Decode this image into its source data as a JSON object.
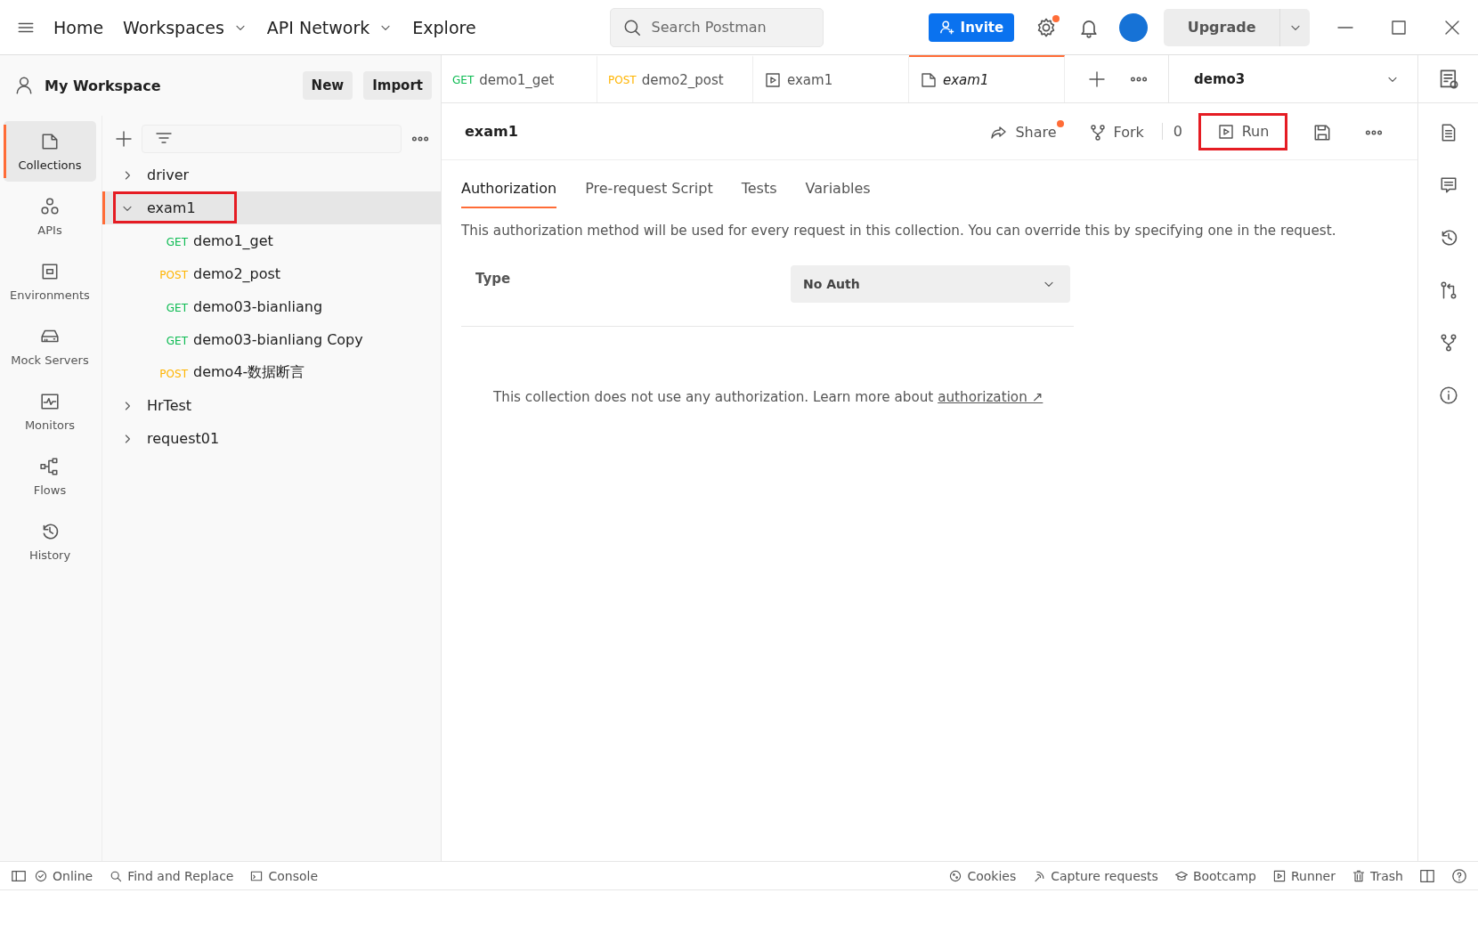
{
  "topbar": {
    "nav": [
      {
        "label": "Home",
        "dropdown": false
      },
      {
        "label": "Workspaces",
        "dropdown": true
      },
      {
        "label": "API Network",
        "dropdown": true
      },
      {
        "label": "Explore",
        "dropdown": false
      }
    ],
    "search": {
      "placeholder": "Search Postman"
    },
    "invite": "Invite",
    "settings_badge": true,
    "upgrade": "Upgrade"
  },
  "workspace": {
    "name": "My Workspace",
    "buttons": [
      "New",
      "Import"
    ]
  },
  "sidebar": {
    "items": [
      {
        "label": "Collections",
        "selected": true
      },
      {
        "label": "APIs",
        "selected": false
      },
      {
        "label": "Environments",
        "selected": false
      },
      {
        "label": "Mock Servers",
        "selected": false
      },
      {
        "label": "Monitors",
        "selected": false
      },
      {
        "label": "Flows",
        "selected": false
      },
      {
        "label": "History",
        "selected": false
      }
    ]
  },
  "tree": [
    {
      "label": "driver",
      "expanded": false,
      "selected": false,
      "annotated": false
    },
    {
      "label": "exam1",
      "expanded": true,
      "selected": true,
      "annotated": true,
      "children": [
        {
          "method": "GET",
          "label": "demo1_get"
        },
        {
          "method": "POST",
          "label": "demo2_post"
        },
        {
          "method": "GET",
          "label": "demo03-bianliang"
        },
        {
          "method": "GET",
          "label": "demo03-bianliang Copy"
        },
        {
          "method": "POST",
          "label": "demo4-数据断言"
        }
      ]
    },
    {
      "label": "HrTest",
      "expanded": false,
      "selected": false,
      "annotated": false
    },
    {
      "label": "request01",
      "expanded": false,
      "selected": false,
      "annotated": false
    }
  ],
  "tabs": [
    {
      "kind": "request",
      "method": "GET",
      "label": "demo1_get",
      "selected": false,
      "preview": false
    },
    {
      "kind": "request",
      "method": "POST",
      "label": "demo2_post",
      "selected": false,
      "preview": false
    },
    {
      "kind": "runner",
      "label": "exam1",
      "selected": false,
      "preview": false
    },
    {
      "kind": "collection",
      "label": "exam1",
      "selected": true,
      "preview": true
    }
  ],
  "environment": "demo3",
  "collection": {
    "title": "exam1",
    "share": "Share",
    "share_badge": true,
    "fork": "Fork",
    "fork_count": "0",
    "run": "Run",
    "run_annotated": true,
    "subtabs": [
      {
        "label": "Authorization",
        "selected": true
      },
      {
        "label": "Pre-request Script",
        "selected": false
      },
      {
        "label": "Tests",
        "selected": false
      },
      {
        "label": "Variables",
        "selected": false
      }
    ],
    "description": "This authorization method will be used for every request in this collection. You can override this by specifying one in the request.",
    "type_label": "Type",
    "auth_type": "No Auth",
    "note": "This collection does not use any authorization. Learn more about ",
    "note_link": "authorization",
    "note_link_arrow": "↗"
  },
  "status_bar": {
    "left": [
      {
        "kind": "online",
        "label": "Online"
      },
      {
        "kind": "find",
        "label": "Find and Replace"
      },
      {
        "kind": "console",
        "label": "Console"
      }
    ],
    "right": [
      {
        "kind": "cookies",
        "label": "Cookies"
      },
      {
        "kind": "capture",
        "label": "Capture requests"
      },
      {
        "kind": "bootcamp",
        "label": "Bootcamp"
      },
      {
        "kind": "runner",
        "label": "Runner"
      },
      {
        "kind": "trash",
        "label": "Trash"
      }
    ]
  }
}
